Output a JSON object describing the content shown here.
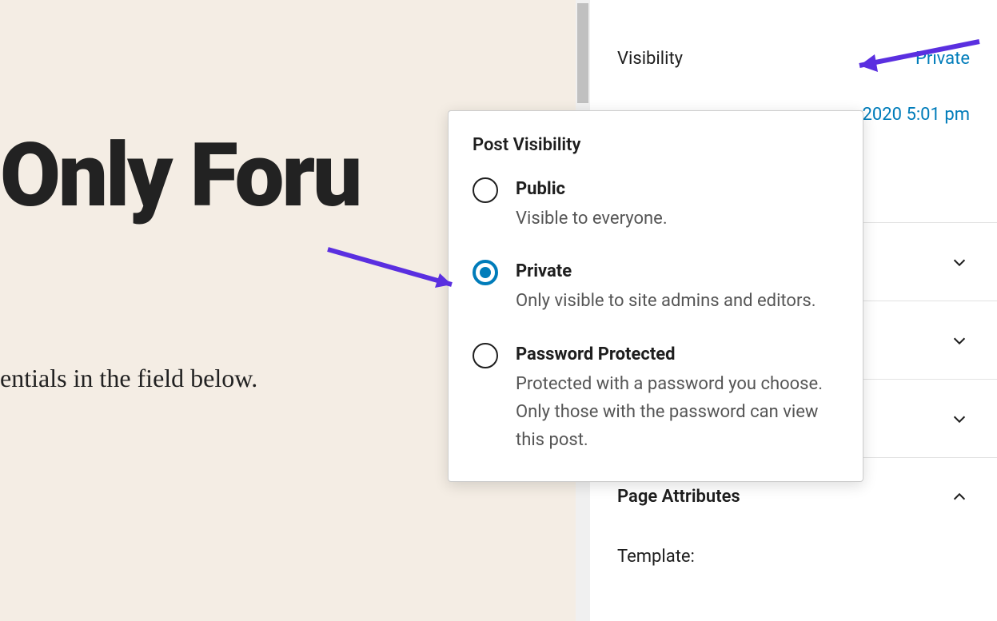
{
  "editor": {
    "title_fragment": "Only Foru",
    "body_fragment": "entials in the field below."
  },
  "sidebar": {
    "visibility_label": "Visibility",
    "visibility_value": "Private",
    "publish_time": "2020 5:01 pm",
    "page_attributes_label": "Page Attributes",
    "template_label": "Template:"
  },
  "popover": {
    "title": "Post Visibility",
    "options": [
      {
        "id": "public",
        "name": "Public",
        "desc": "Visible to everyone.",
        "selected": false
      },
      {
        "id": "private",
        "name": "Private",
        "desc": "Only visible to site admins and editors.",
        "selected": true
      },
      {
        "id": "password",
        "name": "Password Protected",
        "desc": "Protected with a password you choose. Only those with the password can view this post.",
        "selected": false
      }
    ]
  }
}
